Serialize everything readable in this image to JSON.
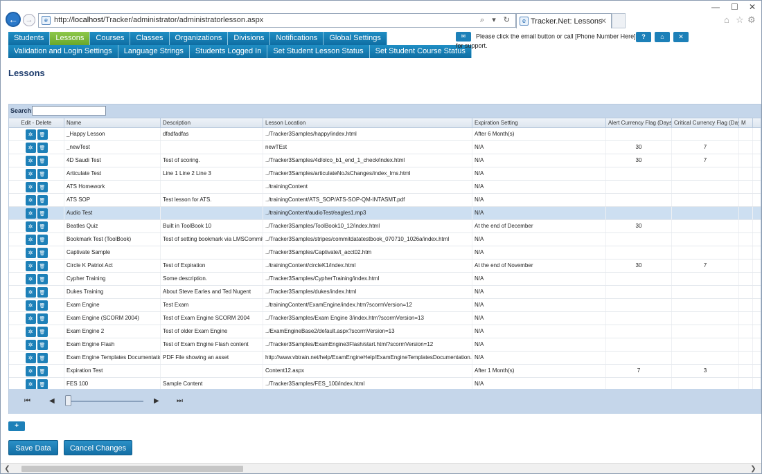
{
  "browser": {
    "url_prefix": "http://",
    "url_host": "localhost",
    "url_path": "/Tracker/administrator/administratorlesson.aspx",
    "tab_title": "Tracker.Net: Lessons",
    "search_glyph": "⌕ ▾ ↻"
  },
  "nav": {
    "row1": [
      {
        "label": "Students",
        "active": false
      },
      {
        "label": "Lessons",
        "active": true
      },
      {
        "label": "Courses",
        "active": false
      },
      {
        "label": "Classes",
        "active": false
      },
      {
        "label": "Organizations",
        "active": false
      },
      {
        "label": "Divisions",
        "active": false
      },
      {
        "label": "Notifications",
        "active": false
      },
      {
        "label": "Global Settings",
        "active": false
      }
    ],
    "row2": [
      {
        "label": "Validation and Login Settings"
      },
      {
        "label": "Language Strings"
      },
      {
        "label": "Students Logged In"
      },
      {
        "label": "Set Student Lesson Status"
      },
      {
        "label": "Set Student Course Status"
      }
    ]
  },
  "support": {
    "text": "Please click the email button or call [Phone Number Here] for support."
  },
  "page": {
    "title": "Lessons"
  },
  "grid": {
    "search_label": "Search:",
    "columns": [
      "Edit - Delete",
      "Name",
      "Description",
      "Lesson Location",
      "Expiration Setting",
      "Alert Currency Flag (Days)",
      "Critical Currency Flag (Days)",
      "M"
    ],
    "rows": [
      {
        "name": "_Happy Lesson",
        "desc": "dfadfadfas",
        "loc": "../Tracker3Samples/happy/index.html",
        "exp": "After 6 Month(s)",
        "alert": "",
        "crit": ""
      },
      {
        "name": "_newTest",
        "desc": "",
        "loc": "newTEst",
        "exp": "N/A",
        "alert": "30",
        "crit": "7"
      },
      {
        "name": "4D Saudi Test",
        "desc": "Test of scoring.",
        "loc": "../Tracker3Samples/4d/olco_b1_end_1_check/index.html",
        "exp": "N/A",
        "alert": "30",
        "crit": "7"
      },
      {
        "name": "Articulate Test",
        "desc": "Line 1 Line 2 Line 3",
        "loc": "../Tracker3Samples/articulateNoJsChanges/index_lms.html",
        "exp": "N/A",
        "alert": "",
        "crit": ""
      },
      {
        "name": "ATS Homework",
        "desc": "",
        "loc": "../trainingContent",
        "exp": "N/A",
        "alert": "",
        "crit": ""
      },
      {
        "name": "ATS SOP",
        "desc": "Test lesson for ATS.",
        "loc": "../trainingContent/ATS_SOP/ATS-SOP-QM-INTASMT.pdf",
        "exp": "N/A",
        "alert": "",
        "crit": ""
      },
      {
        "name": "Audio Test",
        "desc": "",
        "loc": "../trainingContent/audioTest/eagles1.mp3",
        "exp": "N/A",
        "alert": "",
        "crit": "",
        "selected": true
      },
      {
        "name": "Beatles Quiz",
        "desc": "Built in ToolBook 10",
        "loc": "../Tracker3Samples/ToolBook10_12/index.html",
        "exp": "At the end of December",
        "alert": "30",
        "crit": ""
      },
      {
        "name": "Bookmark Test (ToolBook)",
        "desc": "Test of setting bookmark via LMSCommit()",
        "loc": "../Tracker3Samples/stripes/commitdatatestbook_070710_1026a/index.html",
        "exp": "N/A",
        "alert": "",
        "crit": ""
      },
      {
        "name": "Captivate Sample",
        "desc": "",
        "loc": "../Tracker3Samples/Captivate/t_acct02.htm",
        "exp": "N/A",
        "alert": "",
        "crit": ""
      },
      {
        "name": "Circle K Patriot Act",
        "desc": "Test of Expiration",
        "loc": "../trainingContent/circleK1/index.html",
        "exp": "At the end of November",
        "alert": "30",
        "crit": "7"
      },
      {
        "name": "Cypher Training",
        "desc": "Some description.",
        "loc": "../Tracker3Samples/CypherTraining/index.html",
        "exp": "N/A",
        "alert": "",
        "crit": ""
      },
      {
        "name": "Dukes Training",
        "desc": "About Steve Earles and Ted Nugent",
        "loc": "../Tracker3Samples/dukes/index.html",
        "exp": "N/A",
        "alert": "",
        "crit": ""
      },
      {
        "name": "Exam Engine",
        "desc": "Test Exam",
        "loc": "../trainingContent/ExamEngine/index.htm?scormVersion=12",
        "exp": "N/A",
        "alert": "",
        "crit": ""
      },
      {
        "name": "Exam Engine (SCORM 2004)",
        "desc": "Test of Exam Engine SCORM 2004",
        "loc": "../Tracker3Samples/Exam Engine 3/index.htm?scormVersion=13",
        "exp": "N/A",
        "alert": "",
        "crit": ""
      },
      {
        "name": "Exam Engine 2",
        "desc": "Test of older Exam Engine",
        "loc": "../ExamEngineBase2/default.aspx?scormVersion=13",
        "exp": "N/A",
        "alert": "",
        "crit": ""
      },
      {
        "name": "Exam Engine Flash",
        "desc": "Test of Exam Engine Flash content",
        "loc": "../Tracker3Samples/ExamEngine3Flash/start.html?scormVersion=12",
        "exp": "N/A",
        "alert": "",
        "crit": ""
      },
      {
        "name": "Exam Engine Templates Documentation",
        "desc": "PDF File showing an asset",
        "loc": "http://www.vbtrain.net/help/ExamEngineHelp/ExamEngineTemplatesDocumentation.pdf",
        "exp": "N/A",
        "alert": "",
        "crit": ""
      },
      {
        "name": "Expiration Test",
        "desc": "",
        "loc": "Content12.aspx",
        "exp": "After 1 Month(s)",
        "alert": "7",
        "crit": "3"
      },
      {
        "name": "FES 100",
        "desc": "Sample Content",
        "loc": "../Tracker3Samples/FES_100/index.html",
        "exp": "N/A",
        "alert": "",
        "crit": ""
      }
    ]
  },
  "pager": {
    "first": "⏮",
    "prev": "◀",
    "next": "▶",
    "last": "⏭",
    "slider_position": 0
  },
  "actions": {
    "add": "+",
    "save": "Save Data",
    "cancel": "Cancel Changes"
  },
  "colors": {
    "accent": "#1d80b8",
    "active_nav": "#7ab83a",
    "title": "#1b3a6b",
    "grid_bg": "#c5d6ea",
    "selected_row": "#cddff1"
  }
}
